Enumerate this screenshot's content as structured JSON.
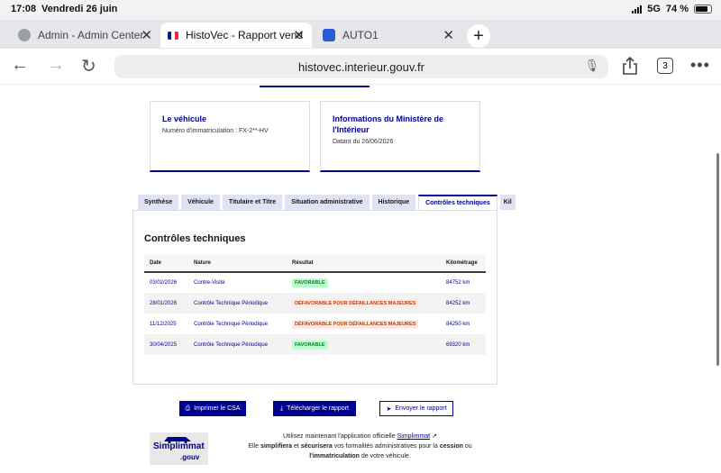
{
  "status": {
    "time": "17:08",
    "date": "Vendredi 26 juin",
    "network": "5G",
    "battery": "74 %"
  },
  "browser": {
    "tabs": [
      {
        "title": "Admin - Admin Center"
      },
      {
        "title": "HistoVec - Rapport vend"
      },
      {
        "title": "AUTO1"
      }
    ],
    "url": "histovec.interieur.gouv.fr",
    "tab_count": "3"
  },
  "cards": {
    "vehicle": {
      "title": "Le véhicule",
      "sub": "Numéro d'immatriculation : FX-2**-HV"
    },
    "ministry": {
      "title": "Informations du Ministère de l'Intérieur",
      "sub": "Datant du 26/06/2026"
    }
  },
  "report_tabs": [
    "Synthèse",
    "Véhicule",
    "Titulaire et Titre",
    "Situation administrative",
    "Historique",
    "Contrôles techniques",
    "Kil"
  ],
  "controls": {
    "title": "Contrôles techniques",
    "headers": [
      "Date",
      "Nature",
      "Résultat",
      "Kilométrage"
    ],
    "rows": [
      {
        "date": "03/02/2026",
        "nature": "Contre-Visite",
        "result": "FAVORABLE",
        "km": "84752 km"
      },
      {
        "date": "28/01/2026",
        "nature": "Contrôle Technique Périodique",
        "result": "DÉFAVORABLE POUR DÉFAILLANCES MAJEURES",
        "km": "84252 km"
      },
      {
        "date": "11/12/2025",
        "nature": "Contrôle Technique Périodique",
        "result": "DÉFAVORABLE POUR DÉFAILLANCES MAJEURES",
        "km": "84250 km"
      },
      {
        "date": "30/04/2025",
        "nature": "Contrôle Technique Périodique",
        "result": "FAVORABLE",
        "km": "69320 km"
      }
    ]
  },
  "actions": {
    "print": "Imprimer le CSA",
    "download": "Télécharger le rapport",
    "send": "Envoyer le rapport"
  },
  "footer": {
    "logo_main": "Simplimmat",
    "logo_sub": ".gouv",
    "line1_pre": "Utilisez maintenant l'application officielle",
    "link": "Simplimmat",
    "line2_pre": "Elle",
    "w1": "simplifiera",
    "mid1": "et",
    "w2": "sécurisera",
    "mid2": "vos formalités administratives pour la",
    "w3": "cession",
    "mid3": "ou",
    "w4": "l'immatriculation",
    "end": "de votre véhicule."
  },
  "colors": {
    "accent": "#000091",
    "ok_bg": "#b8fec9",
    "ko_bg": "#ffe9e6"
  }
}
